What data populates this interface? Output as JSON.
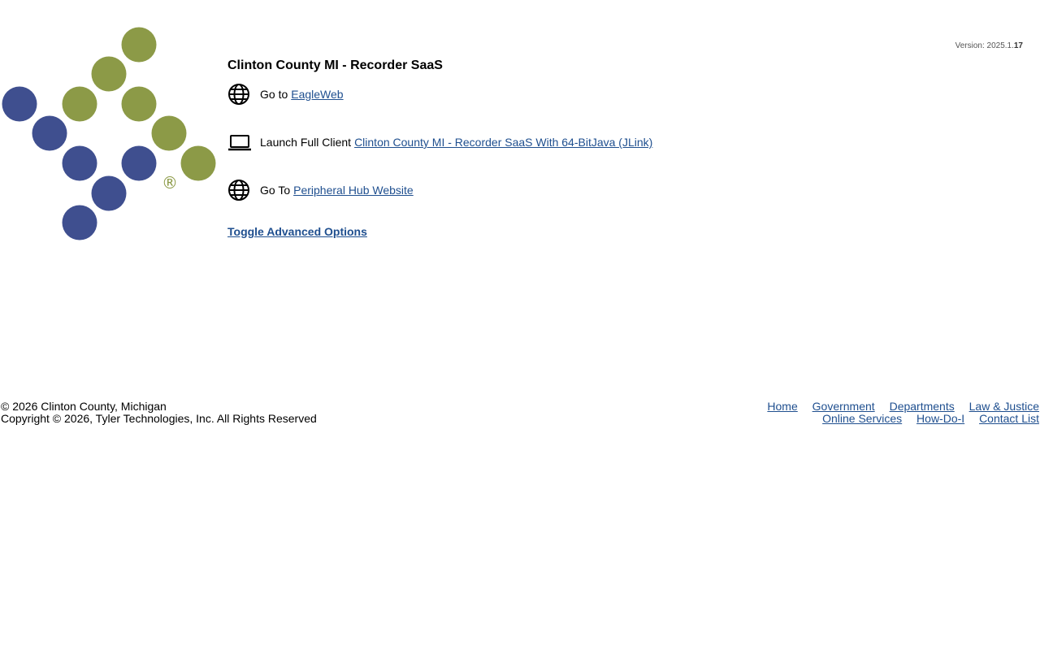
{
  "version": {
    "prefix": "Version: 2025.1.",
    "build": "17"
  },
  "title": "Clinton County MI - Recorder SaaS",
  "rows": [
    {
      "prefix": "Go to",
      "link": "EagleWeb",
      "icon": "globe-icon"
    },
    {
      "prefix": "Launch Full Client",
      "link": "Clinton County MI - Recorder SaaS With 64-BitJava (JLink)",
      "icon": "laptop-icon"
    },
    {
      "prefix": "Go To",
      "link": "Peripheral Hub Website",
      "icon": "globe-icon"
    }
  ],
  "toggle_label": "Toggle Advanced Options",
  "footer": {
    "line1": "© 2026 Clinton County, Michigan",
    "line2": "Copyright © 2026, Tyler Technologies, Inc. All Rights Reserved"
  },
  "footer_nav": [
    "Home",
    "Government",
    "Departments",
    "Law & Justice",
    "Online Services",
    "How-Do-I",
    "Contact List"
  ],
  "colors": {
    "logo_blue": "#3f4f8f",
    "logo_green": "#8c9a47",
    "link": "#1f4f8f"
  },
  "logo_mark": "®"
}
